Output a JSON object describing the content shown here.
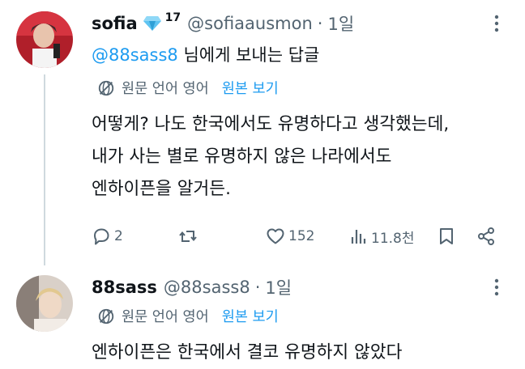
{
  "tweets": [
    {
      "name": "sofia",
      "badge_count": "17",
      "handle": "@sofiaausmon",
      "separator": "·",
      "time": "1일",
      "reply_mention": "@88sass8",
      "reply_suffix": " 님에게 보내는 답글",
      "translate_label": "원문 언어 영어",
      "translate_link": "원본 보기",
      "lines": [
        "어떻게? 나도 한국에서도 유명하다고 생각했는데,",
        "내가 사는 별로 유명하지 않은 나라에서도",
        "엔하이픈을 알거든."
      ],
      "actions": {
        "replies": "2",
        "retweets": "",
        "likes": "152",
        "views": "11.8천"
      }
    },
    {
      "name": "88sass",
      "handle": "@88sass8",
      "separator": "·",
      "time": "1일",
      "translate_label": "원문 언어 영어",
      "translate_link": "원본 보기",
      "lines": [
        "엔하이픈은 한국에서 결코 유명하지 않았다"
      ]
    }
  ],
  "colors": {
    "accent": "#1d9bf0",
    "muted": "#536471",
    "text": "#0f1419",
    "thread_line": "#cfd9de"
  },
  "icons": [
    "more-icon",
    "globe-icon",
    "reply-icon",
    "retweet-icon",
    "like-icon",
    "views-icon",
    "bookmark-icon",
    "share-icon",
    "verified-gem-icon"
  ]
}
